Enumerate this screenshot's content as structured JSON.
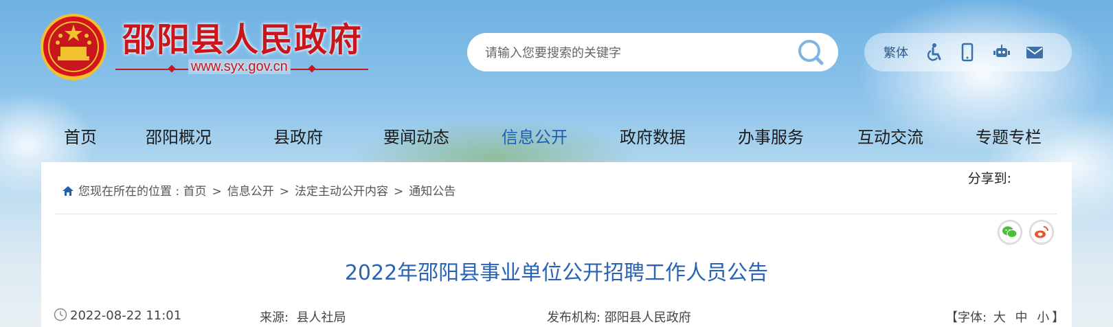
{
  "header": {
    "site_name": "邵阳县人民政府",
    "site_url": "www.syx.gov.cn",
    "search_placeholder": "请输入您要搜索的关键字",
    "traditional_label": "繁体",
    "tool_icons": [
      "accessibility-icon",
      "mobile-icon",
      "robot-icon",
      "mail-icon"
    ]
  },
  "nav": {
    "items": [
      {
        "label": "首页"
      },
      {
        "label": "邵阳概况"
      },
      {
        "label": "县政府"
      },
      {
        "label": "要闻动态"
      },
      {
        "label": "信息公开",
        "active": true
      },
      {
        "label": "政府数据"
      },
      {
        "label": "办事服务"
      },
      {
        "label": "互动交流"
      },
      {
        "label": "专题专栏"
      }
    ]
  },
  "breadcrumb": {
    "prefix": "您现在所在的位置 : ",
    "items": [
      "首页",
      "信息公开",
      "法定主动公开内容",
      "通知公告"
    ],
    "separator": ">"
  },
  "share": {
    "label": "分享到:",
    "services": [
      "wechat-icon",
      "weibo-icon"
    ]
  },
  "article": {
    "title": "2022年邵阳县事业单位公开招聘工作人员公告",
    "date": "2022-08-22 11:01",
    "source_label": "来源:",
    "source_value": "县人社局",
    "publisher_label": "发布机构:",
    "publisher_value": "邵阳县人民政府",
    "font_size_prefix": "【字体:",
    "font_size_options": [
      "大",
      "中",
      "小"
    ],
    "font_size_suffix": "】"
  },
  "colors": {
    "brand_red": "#c8161d",
    "accent_blue": "#2a63b4",
    "nav_active": "#1f5fb0",
    "wechat_green": "#4bbf3a",
    "weibo_orange": "#e9552c"
  }
}
